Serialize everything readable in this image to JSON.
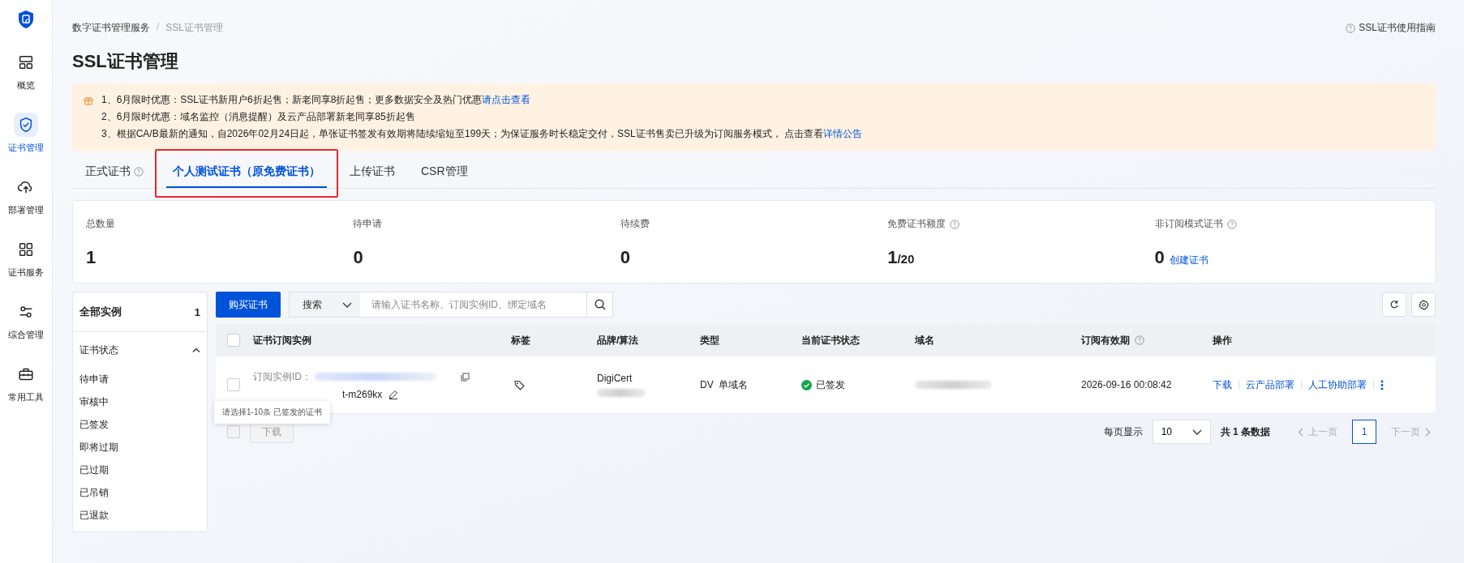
{
  "sidebar": {
    "items": [
      {
        "label": "概览",
        "selected": false
      },
      {
        "label": "证书管理",
        "selected": true
      },
      {
        "label": "部署管理",
        "selected": false
      },
      {
        "label": "证书服务",
        "selected": false
      },
      {
        "label": "综合管理",
        "selected": false
      },
      {
        "label": "常用工具",
        "selected": false
      }
    ]
  },
  "breadcrumb": {
    "separator": "/",
    "items": [
      "数字证书管理服务",
      "SSL证书管理"
    ]
  },
  "guide_link": "SSL证书使用指南",
  "title": "SSL证书管理",
  "notice": {
    "lines": [
      {
        "text": "1、6月限时优惠：SSL证书新用户6折起售；新老同享8折起售；更多数据安全及热门优惠",
        "link": "请点击查看"
      },
      {
        "text": "2、6月限时优惠：域名监控（消息提醒）及云产品部署新老同享85折起售"
      },
      {
        "text": "3、根据CA/B最新的通知，自2026年02月24日起，单张证书签发有效期将陆续缩短至199天；为保证服务时长稳定交付，SSL证书售卖已升级为订阅服务模式， 点击查看",
        "link": "详情公告"
      }
    ]
  },
  "tabs": [
    {
      "label": "正式证书",
      "help": true,
      "selected": false,
      "highlighted": false
    },
    {
      "label": "个人测试证书（原免费证书）",
      "help": false,
      "selected": true,
      "highlighted": true
    },
    {
      "label": "上传证书",
      "help": false,
      "selected": false,
      "highlighted": false
    },
    {
      "label": "CSR管理",
      "help": false,
      "selected": false,
      "highlighted": false
    }
  ],
  "stats": [
    {
      "label": "总数量",
      "help": false,
      "value": "1"
    },
    {
      "label": "待申请",
      "help": false,
      "value": "0"
    },
    {
      "label": "待续费",
      "help": false,
      "value": "0"
    },
    {
      "label": "免费证书额度",
      "help": true,
      "value": "1",
      "suffix": "/20"
    },
    {
      "label": "非订阅模式证书",
      "help": true,
      "value": "0",
      "link": "创建证书"
    }
  ],
  "filter_panel": {
    "all_label": "全部实例",
    "all_count": "1",
    "group_label": "证书状态",
    "expanded": true,
    "items": [
      "待申请",
      "审核中",
      "已签发",
      "即将过期",
      "已过期",
      "已吊销",
      "已退款"
    ]
  },
  "toolbar": {
    "buy_button": "购买证书",
    "search_scope": "搜索",
    "search_placeholder": "请输入证书名称、订阅实例ID、绑定域名"
  },
  "table": {
    "header_checked": false,
    "columns": [
      {
        "label": "证书订阅实例",
        "help": false
      },
      {
        "label": "标签",
        "help": false
      },
      {
        "label": "品牌/算法",
        "help": false
      },
      {
        "label": "类型",
        "help": false
      },
      {
        "label": "当前证书状态",
        "help": false
      },
      {
        "label": "域名",
        "help": false
      },
      {
        "label": "订阅有效期",
        "help": true
      },
      {
        "label": "操作",
        "help": false
      }
    ],
    "rows": [
      {
        "checked": false,
        "instance_id_label": "订阅实例ID：",
        "instance_name": "t-m269kx",
        "brand": "DigiCert",
        "type": "DV  单域名",
        "status": {
          "label": "已签发",
          "kind": "issued"
        },
        "expiry": "2026-09-16 00:08:42",
        "actions": [
          "下载",
          "云产品部署",
          "人工协助部署"
        ]
      }
    ]
  },
  "tooltip": "请选择1-10条 已签发的证书",
  "bulk": {
    "checked": false,
    "download": "下载",
    "disabled": true
  },
  "pagination": {
    "page_size_label": "每页显示",
    "page_size": "10",
    "total": "共 1 条数据",
    "prev": "上一页",
    "next": "下一页",
    "pages": [
      {
        "label": "1",
        "selected": true
      }
    ]
  }
}
